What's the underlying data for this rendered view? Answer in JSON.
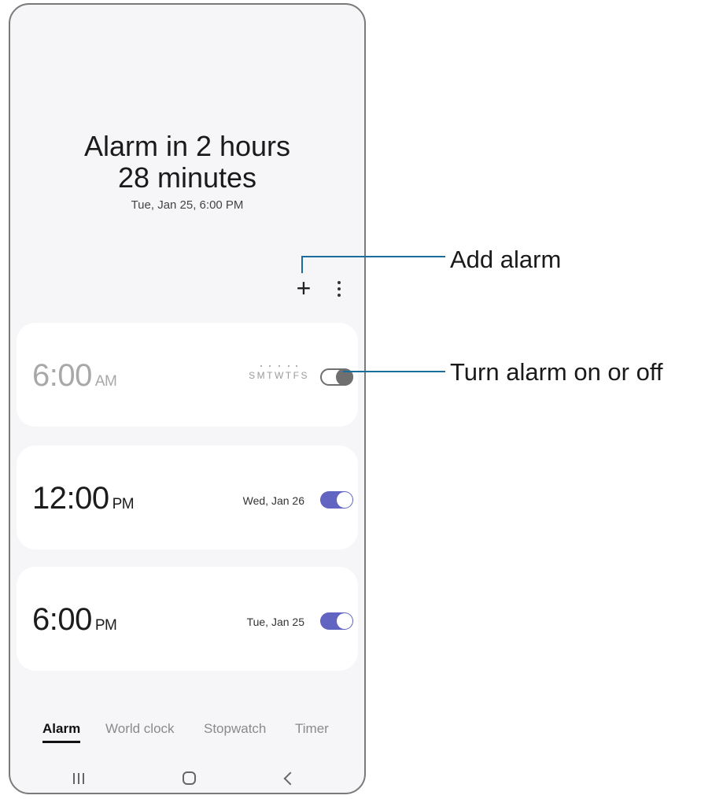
{
  "header": {
    "line1": "Alarm in 2 hours",
    "line2": "28 minutes",
    "next_alarm": "Tue, Jan 25, 6:00 PM"
  },
  "actions": {
    "add_icon": "plus-icon",
    "add_glyph": "+",
    "more_icon": "more-vertical-icon"
  },
  "alarms": [
    {
      "time": "6:00",
      "ampm": "AM",
      "days": [
        "S",
        "M",
        "T",
        "W",
        "T",
        "F",
        "S"
      ],
      "date": "",
      "enabled": false
    },
    {
      "time": "12:00",
      "ampm": "PM",
      "days": [],
      "date": "Wed, Jan 26",
      "enabled": true
    },
    {
      "time": "6:00",
      "ampm": "PM",
      "days": [],
      "date": "Tue, Jan 25",
      "enabled": true
    }
  ],
  "tabs": [
    {
      "label": "Alarm",
      "active": true
    },
    {
      "label": "World clock",
      "active": false
    },
    {
      "label": "Stopwatch",
      "active": false
    },
    {
      "label": "Timer",
      "active": false
    }
  ],
  "nav": {
    "recent_icon": "recent-apps-icon",
    "home_icon": "home-icon",
    "back_icon": "back-icon"
  },
  "callouts": {
    "add_alarm": "Add alarm",
    "toggle": "Turn alarm on or off"
  },
  "colors": {
    "accent": "#6264c2",
    "callout_line": "#1a6e9c"
  }
}
